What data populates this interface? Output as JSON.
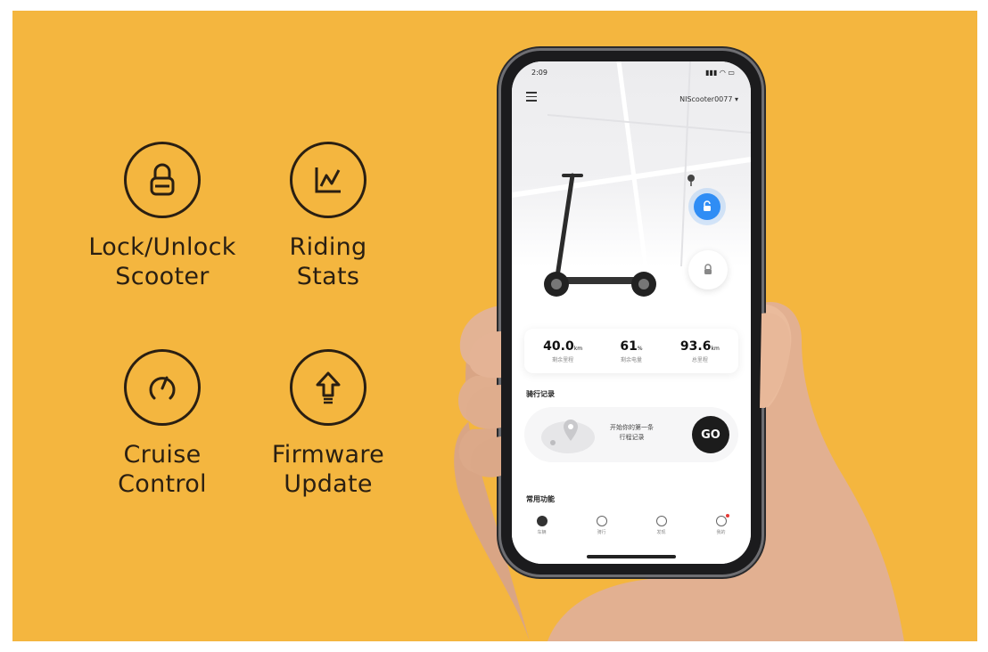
{
  "theme": {
    "banner_bg": "#f4b63f",
    "ink": "#2a1f12",
    "accent": "#2f8df5"
  },
  "features": [
    {
      "icon": "padlock-icon",
      "lines": [
        "Lock/Unlock",
        "Scooter"
      ]
    },
    {
      "icon": "line-chart-icon",
      "lines": [
        "Riding",
        "Stats"
      ]
    },
    {
      "icon": "speedometer-icon",
      "lines": [
        "Cruise",
        "Control"
      ]
    },
    {
      "icon": "up-arrow-icon",
      "lines": [
        "Firmware",
        "Update"
      ]
    }
  ],
  "app": {
    "status_time": "2:09",
    "device_name": "NIScooter0077",
    "stats": [
      {
        "value": "40.0",
        "unit": "km",
        "label": "剩余里程"
      },
      {
        "value": "61",
        "unit": "%",
        "label": "剩余电量"
      },
      {
        "value": "93.6",
        "unit": "km",
        "label": "总里程"
      }
    ],
    "ride_section_title": "骑行记录",
    "ride_prompt_line1": "开始你的第一条",
    "ride_prompt_line2": "行程记录",
    "go_label": "GO",
    "functions_title": "常用功能",
    "tabs": [
      {
        "label": "车辆",
        "active": true
      },
      {
        "label": "骑行",
        "active": false
      },
      {
        "label": "发现",
        "active": false
      },
      {
        "label": "我的",
        "active": false,
        "badge": true
      }
    ]
  }
}
